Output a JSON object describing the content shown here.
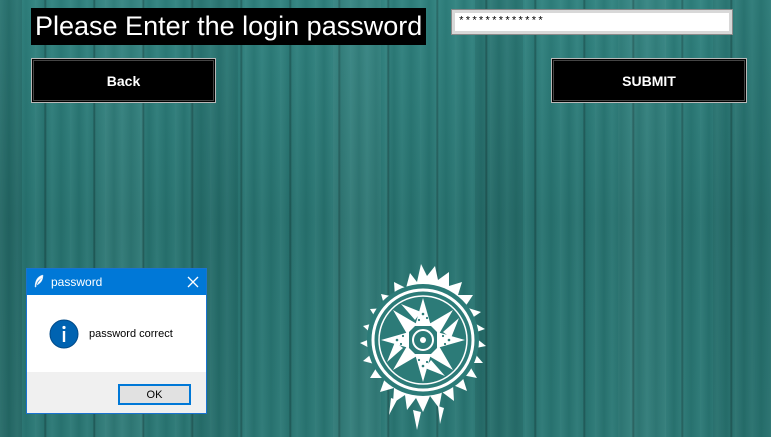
{
  "window": {
    "heading": "Please Enter the login password",
    "password_value": "*************",
    "back_label": "Back",
    "submit_label": "SUBMIT"
  },
  "dialog": {
    "title": "password",
    "message": "password correct",
    "ok_label": "OK"
  },
  "colors": {
    "background_wood": "#2c7b78",
    "button_bg": "#000000",
    "dialog_titlebar": "#0078d7",
    "info_icon": "#0063b1"
  },
  "icons": [
    "feather-icon",
    "close-icon",
    "info-icon",
    "emblem-logo"
  ]
}
